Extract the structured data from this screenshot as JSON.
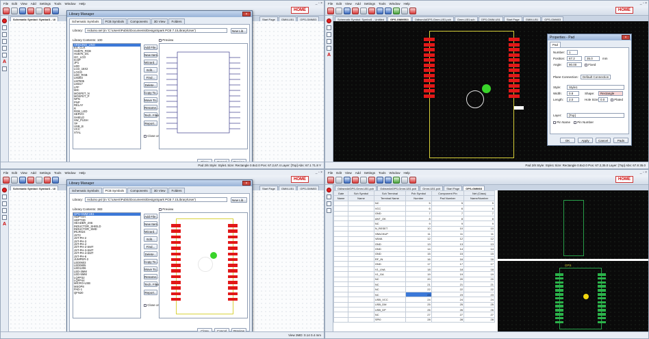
{
  "menu": [
    "File",
    "Edit",
    "View",
    "Add",
    "Settings",
    "Tools",
    "Window",
    "Help"
  ],
  "home_label": "HOME",
  "window_buttons": "_ ▫ ×",
  "q1": {
    "tabs": [
      "Schematic Symbol: Symbol1 - Ul"
    ],
    "right_tabs": [
      "Start Page",
      "GMM-U51",
      "GPS-GMM03"
    ],
    "dialog": {
      "title": "Library Manager",
      "tabs": [
        "Schematic Symbols",
        "PCB Symbols",
        "Components",
        "3D View",
        "Folders"
      ],
      "library_label": "Library:",
      "library_value": "Arduino.sel  (in 'C:\\Users\\Public\\Documents\\DesignSpark PCB 7.1\\Library\\User')",
      "new_lib": "New Lib...",
      "contents_label": "Library Contents:",
      "contents_count": "100",
      "preview_label": "Preview",
      "items": [
        "ARDUINO_UNO",
        "EG_CLK",
        "HUB75_RGB",
        "HUB75_DC",
        "I2C_LCD",
        "ICSP",
        "JP1",
        "LED",
        "LCD_16X2",
        "LOGO",
        "LED_RGB",
        "LM393",
        "LM7805",
        "LM317",
        "LPF",
        "MIC",
        "MOSFET_N",
        "MOSFET_P",
        "NPN",
        "PNP",
        "RELAY",
        "R",
        "RGB_LED",
        "SERVO",
        "SHIELD",
        "SW_PUSH",
        "TP",
        "USB_B",
        "VCC",
        "XTAL"
      ],
      "buttons": [
        "Add File...",
        "New Item...",
        "Wizard...",
        "Edit...",
        "Find...",
        "Delete...",
        "Copy To...",
        "Move To...",
        "Rename...",
        "Tech. Files...",
        "Report..."
      ],
      "close_on_edit": "Close on Edit",
      "footer": [
        "Close",
        "Cancel",
        "Preview"
      ]
    },
    "status": "Pad 2/6 Style: Style1 Size: Rectangle 0.8x2.0 Pos: 67.2,67.4 Layer: [Top] Abs: 67.1 71.8 Y"
  },
  "q2": {
    "tabs": [
      "Schematic Symbol: Symbol1 - Untitled",
      "GPS-GMM5S3",
      "Odbsm4dGPS-Gmm-U51.pcb",
      "Gmm-U51.sch",
      "GPS-GMM-U51",
      "Start Page",
      "GMM-U51",
      "GPS-GMM03"
    ],
    "props": {
      "title": "Properties - Pad",
      "tab": "Pad",
      "number_label": "Number:",
      "number": "1",
      "position_label": "Position:",
      "pos_x": "67.2",
      "pos_y": "35.0",
      "pos_unit": "mm",
      "angle_label": "Angle:",
      "angle": "90.00",
      "fixed": "Fixed",
      "plane_label": "Plane Connection:",
      "plane": "Default Connection",
      "style_label": "Style:",
      "style": "Style1",
      "width_label": "Width:",
      "width": "0.8",
      "shape_label": "Shape:",
      "shape": "Rectangle",
      "length_label": "Length:",
      "length": "2.0",
      "hole_label": "Hole Size:",
      "hole": "0.0",
      "plated": "Plated",
      "layer_label": "Layer:",
      "layer": "[Top]",
      "pin_name": "Pin Name",
      "pin_number": "Pin Number",
      "buttons": [
        "OK",
        "Apply",
        "Cancel",
        "Pads"
      ]
    },
    "status": "Pad 2/8 Style: Style1 Size: Rectangle 0.8x2.0 Pos: 67.2,35.0 Layer: [Top] Abs: 67.8 35.0"
  },
  "q3": {
    "tabs": [
      "Schematic Symbol: Symbol1 - Ul"
    ],
    "right_tabs": [
      "Start Page",
      "GMM-U51",
      "GPS-GMM03"
    ],
    "dialog": {
      "title": "Library Manager",
      "tabs": [
        "Schematic Symbols",
        "PCB Symbols",
        "Components",
        "3D View",
        "Folders"
      ],
      "library_label": "Library:",
      "library_value": "Arduino.psl  (in 'C:\\Users\\Public\\Documents\\DesignSpark PCB 7.1\\Library\\User')",
      "new_lib": "New Lib...",
      "contents_label": "Library Contents:",
      "contents_count": "383",
      "preview_label": "Preview",
      "items": [
        "GPS-GMM-U51",
        "HDPT4H",
        "HDPT3D",
        "HEADER_2X6",
        "INDUCTOR_SHIELD",
        "INDUCTOR_SMD",
        "IRLR024",
        "JST2",
        "JST-PH-2",
        "JST-PH-3",
        "JST-PH-4",
        "JST-PH-2-SMT",
        "JST-PH-3-SMT",
        "JST-PH-4-SMT",
        "JST-PH-6",
        "JUMPER-3",
        "LED0603",
        "LED0805",
        "LED1206",
        "LED-3MM",
        "LED-5MM",
        "LQFP32",
        "LQFP44",
        "MICRO-USB",
        "MSOP8",
        "PAD-1",
        "QFN20"
      ],
      "buttons": [
        "Add File...",
        "New Item...",
        "Wizard...",
        "Edit...",
        "Find...",
        "Delete...",
        "Copy To...",
        "Move To...",
        "Rename...",
        "Tech. Files...",
        "Report..."
      ],
      "close_on_edit": "Close on Edit",
      "footer": [
        "Close",
        "Cancel",
        "Preview"
      ]
    },
    "status": "View 3MD: 0.14 0.4 mm"
  },
  "q4": {
    "tabs": [
      "Odbsm4dGPS-Gmm-U51.pcb",
      "Odbsm4dGPS-Gmm-U51.pcb",
      "Gmm-U51.pcb",
      "Start Page",
      "GPS-GMM03"
    ],
    "table": {
      "headers1": [
        "Gate",
        "Sch Symbol",
        "Sch Terminal",
        "Pcb Symbol",
        "Component Pin",
        "Net (Class)"
      ],
      "headers2": [
        "Name",
        "Name",
        "Terminal Name",
        "Number",
        "Pad Number",
        "Name/Number",
        "Name"
      ],
      "rows": [
        [
          "NC",
          "5",
          "5",
          "5"
        ],
        [
          "VCC",
          "6",
          "6",
          "6"
        ],
        [
          "GND",
          "7",
          "7",
          "7"
        ],
        [
          "ANT_OK",
          "8",
          "8",
          "8"
        ],
        [
          "NC",
          "9",
          "9",
          "9"
        ],
        [
          "N_RESET",
          "10",
          "10",
          "10"
        ],
        [
          "VBACKUP",
          "11",
          "11",
          "11"
        ],
        [
          "VANA",
          "12",
          "12",
          "12"
        ],
        [
          "GND",
          "13",
          "13",
          "13"
        ],
        [
          "GND",
          "14",
          "14",
          "14"
        ],
        [
          "GND",
          "15",
          "15",
          "15"
        ],
        [
          "RF_IN",
          "16",
          "16",
          "16"
        ],
        [
          "GND",
          "17",
          "17",
          "17"
        ],
        [
          "V1_LNA",
          "18",
          "18",
          "18"
        ],
        [
          "V1_GA",
          "19",
          "19",
          "19"
        ],
        [
          "NC",
          "20",
          "20",
          "20"
        ],
        [
          "NC",
          "21",
          "21",
          "21"
        ],
        [
          "NC",
          "22",
          "22",
          "22"
        ],
        [
          "NC",
          "23",
          "23",
          "23"
        ],
        [
          "USB_VCC",
          "24",
          "24",
          "24"
        ],
        [
          "USB_DM",
          "25",
          "25",
          "25"
        ],
        [
          "USB_DP",
          "26",
          "26",
          "26"
        ],
        [
          "NC",
          "27",
          "27",
          "27"
        ],
        [
          "SPI0",
          "28",
          "28",
          "28"
        ]
      ]
    },
    "pcb_label": "GPS",
    "status": ""
  }
}
